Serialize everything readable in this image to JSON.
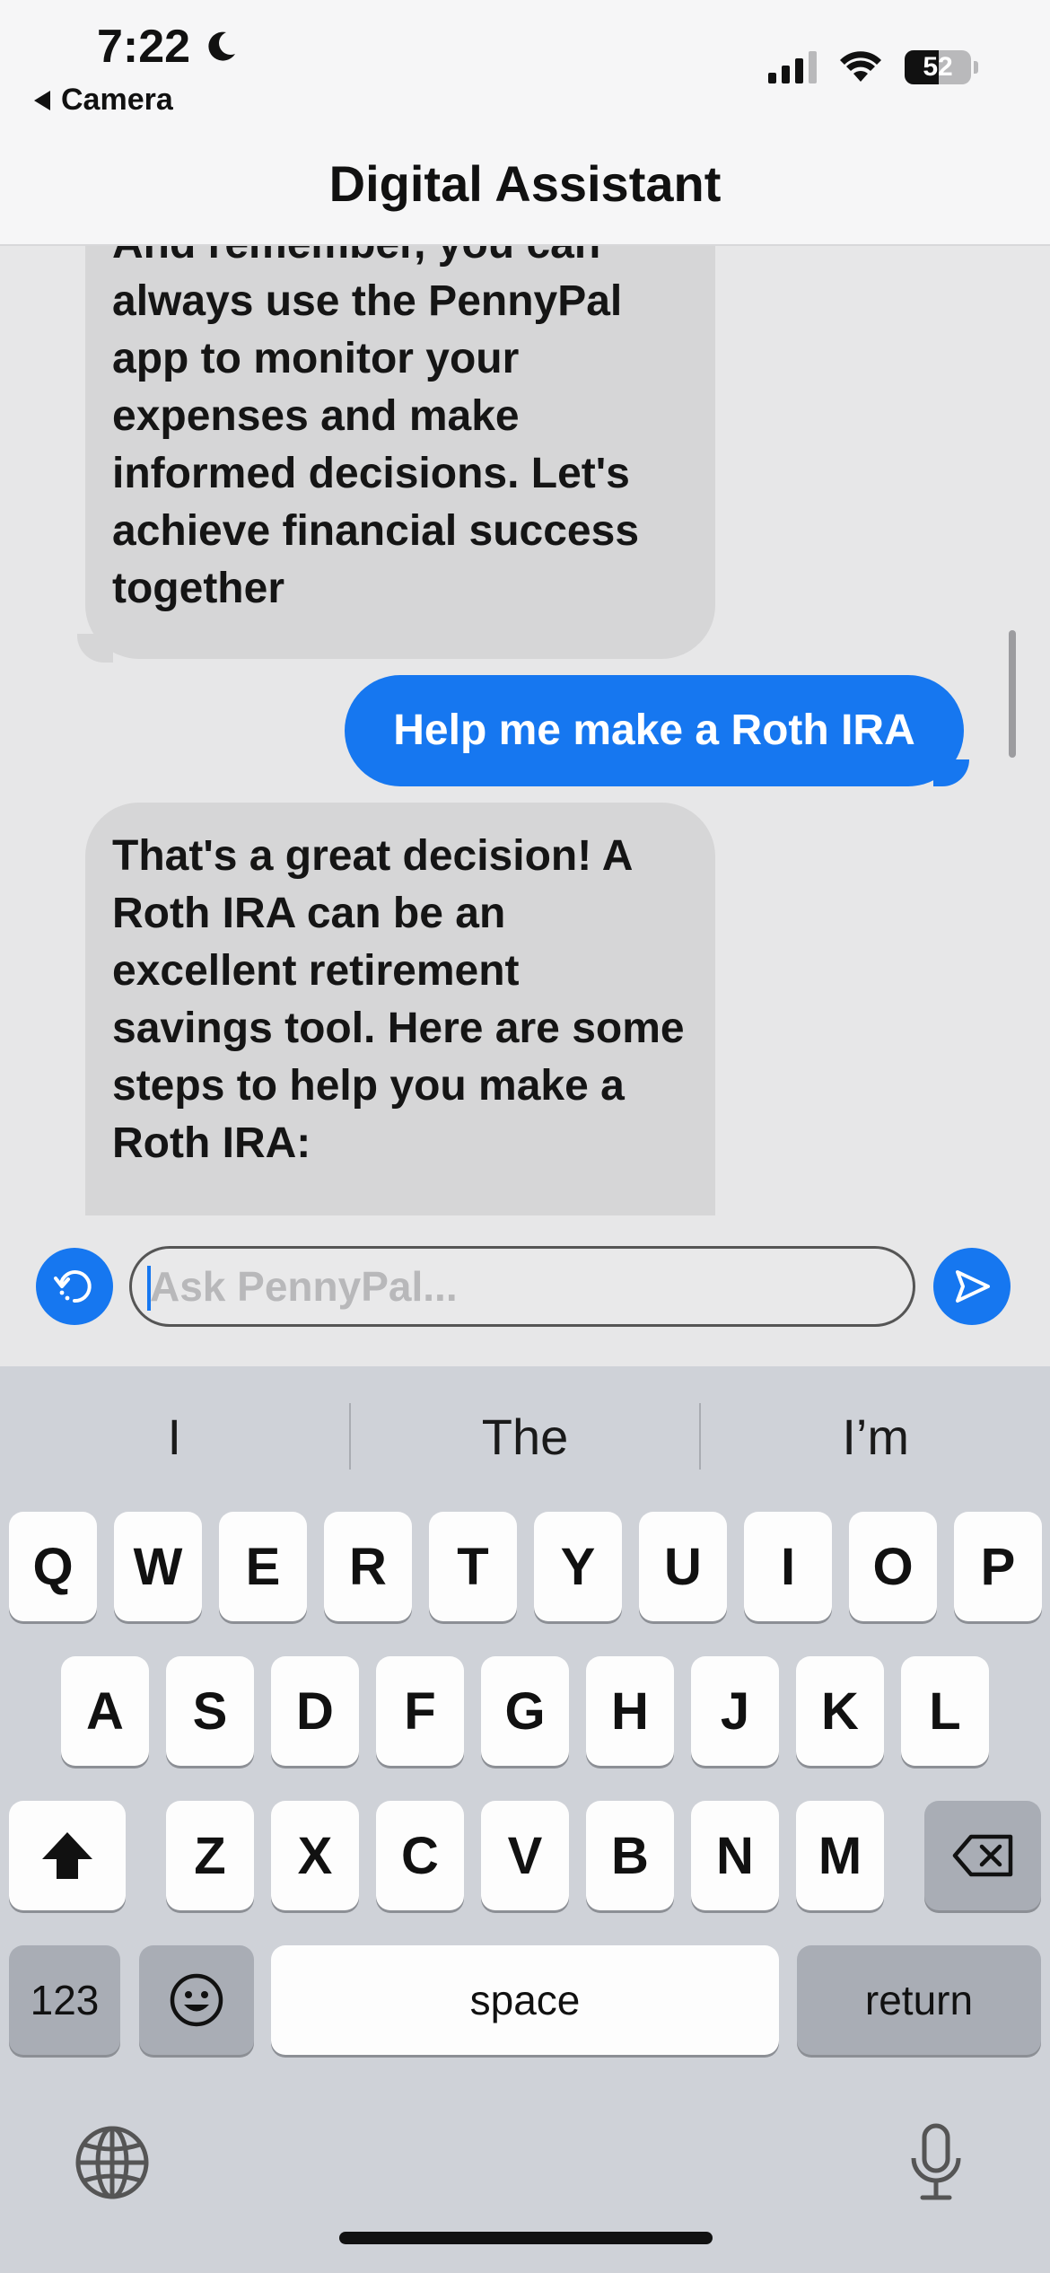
{
  "status_bar": {
    "time": "7:22",
    "back_label": "Camera",
    "battery": "52"
  },
  "header": {
    "title": "Digital Assistant"
  },
  "chat": {
    "messages": [
      {
        "from": "assistant",
        "text": "And remember, you can always use the PennyPal app to monitor your expenses and make informed decisions. Let's achieve financial success together"
      },
      {
        "from": "user",
        "text": "Help me make a Roth IRA"
      },
      {
        "from": "assistant",
        "text": "That's a great decision! A Roth IRA can be an excellent retirement savings tool. Here are some steps to help you make a Roth IRA:"
      }
    ]
  },
  "composer": {
    "placeholder": "Ask PennyPal..."
  },
  "keyboard": {
    "suggestions": [
      "I",
      "The",
      "I’m"
    ],
    "row1": [
      "Q",
      "W",
      "E",
      "R",
      "T",
      "Y",
      "U",
      "I",
      "O",
      "P"
    ],
    "row2": [
      "A",
      "S",
      "D",
      "F",
      "G",
      "H",
      "J",
      "K",
      "L"
    ],
    "row3": [
      "Z",
      "X",
      "C",
      "V",
      "B",
      "N",
      "M"
    ],
    "numbers_label": "123",
    "space_label": "space",
    "return_label": "return"
  },
  "colors": {
    "accent": "#1677f0",
    "assistant_bubble": "#d6d6d7",
    "keyboard_bg": "#cfd2d8"
  }
}
